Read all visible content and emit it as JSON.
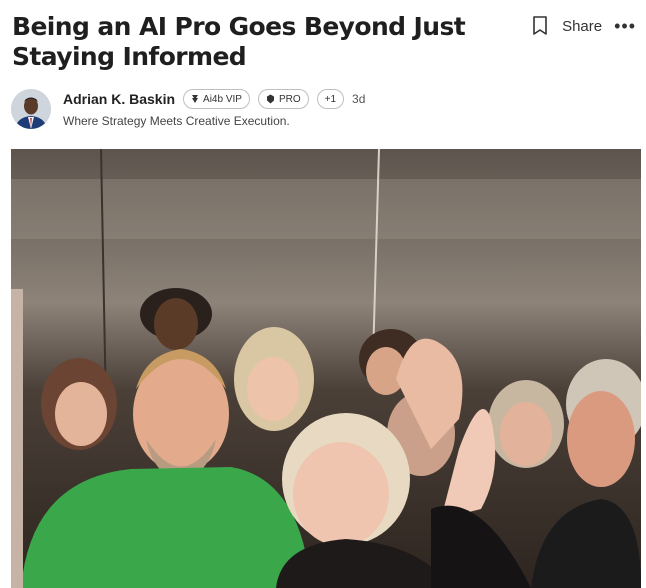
{
  "article": {
    "title": "Being an AI Pro Goes Beyond Just Staying Informed"
  },
  "actions": {
    "bookmark_icon": "bookmark-icon",
    "share_label": "Share",
    "more_icon": "more-options-icon"
  },
  "author": {
    "name": "Adrian K. Baskin",
    "tagline": "Where Strategy Meets Creative Execution.",
    "posted": "3d",
    "badges": [
      {
        "label": "Ai4b VIP",
        "icon": "vip-pin-icon"
      },
      {
        "label": "PRO",
        "icon": "pro-badge-icon"
      },
      {
        "label": "+1"
      }
    ]
  },
  "image": {
    "description_icon": "group-selfie-photo"
  },
  "colors": {
    "title": "#1f1f1f",
    "badge_border": "#bfbfbf",
    "avatar_bg": "#d9dde3"
  }
}
